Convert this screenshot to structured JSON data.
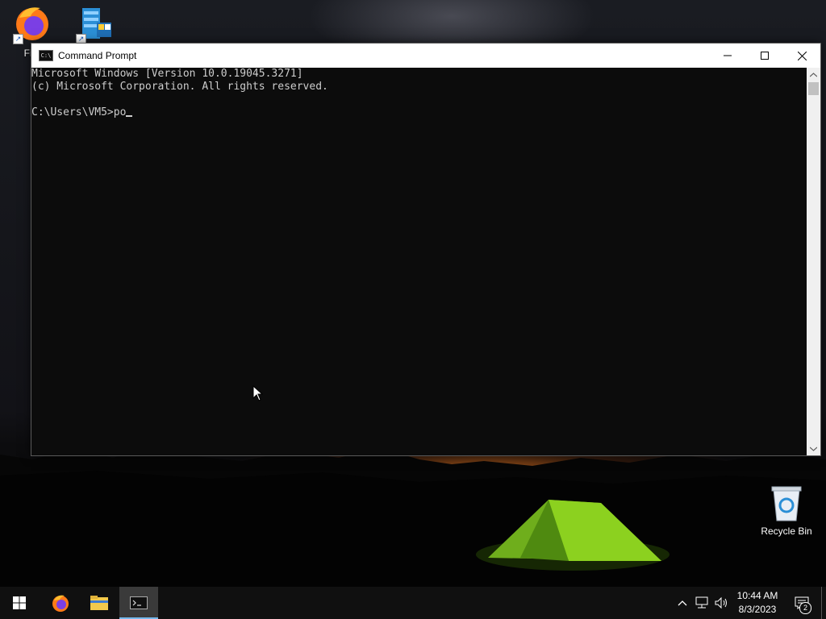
{
  "desktop": {
    "icons": [
      {
        "label": "Fire",
        "icon": "firefox-icon"
      },
      {
        "label": "",
        "icon": "server-manager-icon"
      },
      {
        "label": "Recycle Bin",
        "icon": "recycle-bin-icon"
      }
    ]
  },
  "window": {
    "title": "Command Prompt",
    "controls": {
      "minimize": "minimize-icon",
      "maximize": "maximize-icon",
      "close": "close-icon"
    }
  },
  "console": {
    "lines": [
      "Microsoft Windows [Version 10.0.19045.3271]",
      "(c) Microsoft Corporation. All rights reserved.",
      "",
      "C:\\Users\\VM5>po"
    ]
  },
  "taskbar": {
    "apps": [
      {
        "name": "Start",
        "icon": "windows-logo-icon"
      },
      {
        "name": "Firefox",
        "icon": "firefox-icon"
      },
      {
        "name": "File Explorer",
        "icon": "folder-icon"
      },
      {
        "name": "Command Prompt",
        "icon": "terminal-icon",
        "active": true
      }
    ],
    "tray": {
      "time": "10:44 AM",
      "date": "8/3/2023",
      "notification_count": "2"
    }
  },
  "colors": {
    "console_bg": "#0c0c0c",
    "console_text": "#cccccc",
    "taskbar_bg": "#101010",
    "active_indicator": "#76b9ed"
  }
}
